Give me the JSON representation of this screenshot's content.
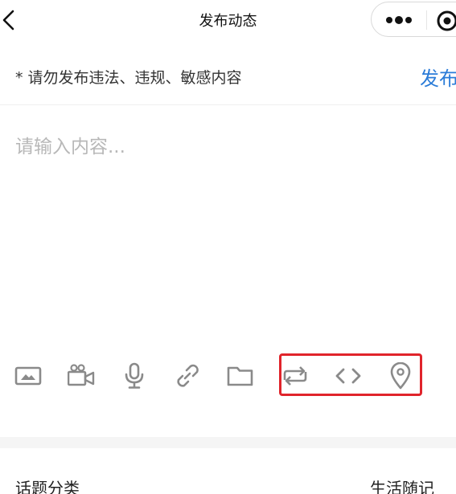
{
  "header": {
    "title": "发布动态",
    "back_icon": "chevron-left-icon",
    "more_icon": "more-dots-icon",
    "close_icon": "target-circle-icon"
  },
  "notice": {
    "text": "* 请勿发布违法、违规、敏感内容",
    "publish_label": "发布"
  },
  "editor": {
    "placeholder": "请输入内容..."
  },
  "toolbar": {
    "tools": [
      {
        "name": "image-icon"
      },
      {
        "name": "video-icon"
      },
      {
        "name": "microphone-icon"
      },
      {
        "name": "link-icon"
      },
      {
        "name": "folder-icon"
      },
      {
        "name": "repost-icon"
      },
      {
        "name": "code-icon"
      },
      {
        "name": "location-pin-icon"
      }
    ],
    "highlight_color": "#e0242b"
  },
  "topic": {
    "label": "话题分类",
    "value": "生活随记"
  },
  "colors": {
    "accent": "#2b7cd8",
    "icon_gray": "#8a8a8a",
    "placeholder": "#b8b8b8"
  }
}
